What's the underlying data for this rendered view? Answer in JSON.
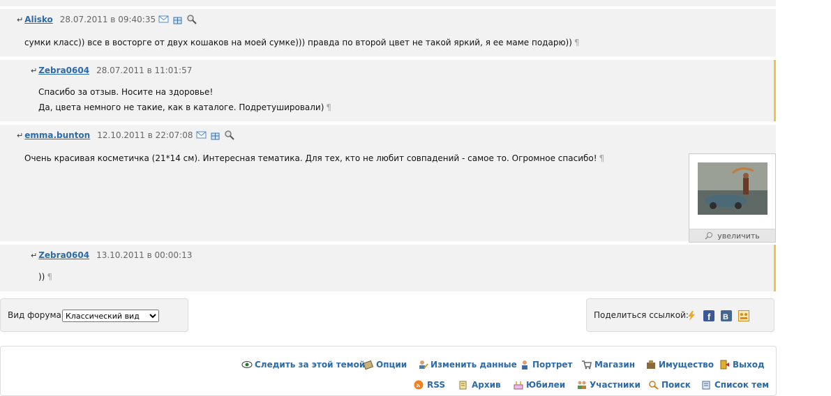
{
  "posts": [
    {
      "author": "Alisko",
      "date": "28.07.2011 в 09:40:35",
      "text": "сумки класс)) все в восторге от двух кошаков на моей сумке))) правда по второй цвет не такой яркий, я ее маме подарю))"
    },
    {
      "author": "Zebra0604",
      "date": "28.07.2011 в 11:01:57",
      "line1": "Спасибо за отзыв. Носите на здоровье!",
      "line2": "Да, цвета немного не такие, как в каталоге. Подретушировали)"
    },
    {
      "author": "emma.bunton",
      "date": "12.10.2011 в 22:07:08",
      "text": "Очень красивая косметичка (21*14 см). Интересная тематика. Для тех, кто не любит совпадений - самое то. Огромное спасибо!",
      "enlarge": "увеличить"
    },
    {
      "author": "Zebra0604",
      "date": "13.10.2011 в 00:00:13",
      "text": "))"
    }
  ],
  "pilcrow": "¶",
  "reply_arrow": "↵",
  "forum_view": {
    "label": "Вид форума:",
    "selected": "Классический вид"
  },
  "share": {
    "label": "Поделиться ссылкой:"
  },
  "nav_row1": [
    "Следить за этой темой",
    "Опции",
    "Изменить данные",
    "Портрет",
    "Магазин",
    "Имущество",
    "Выход"
  ],
  "nav_row2": [
    "RSS",
    "Архив",
    "Юбилеи",
    "Участники",
    "Поиск",
    "Список тем"
  ],
  "colors": {
    "link": "#2d6aa8",
    "accent": "#f0c24a",
    "post_bg": "#f2f2f2"
  }
}
